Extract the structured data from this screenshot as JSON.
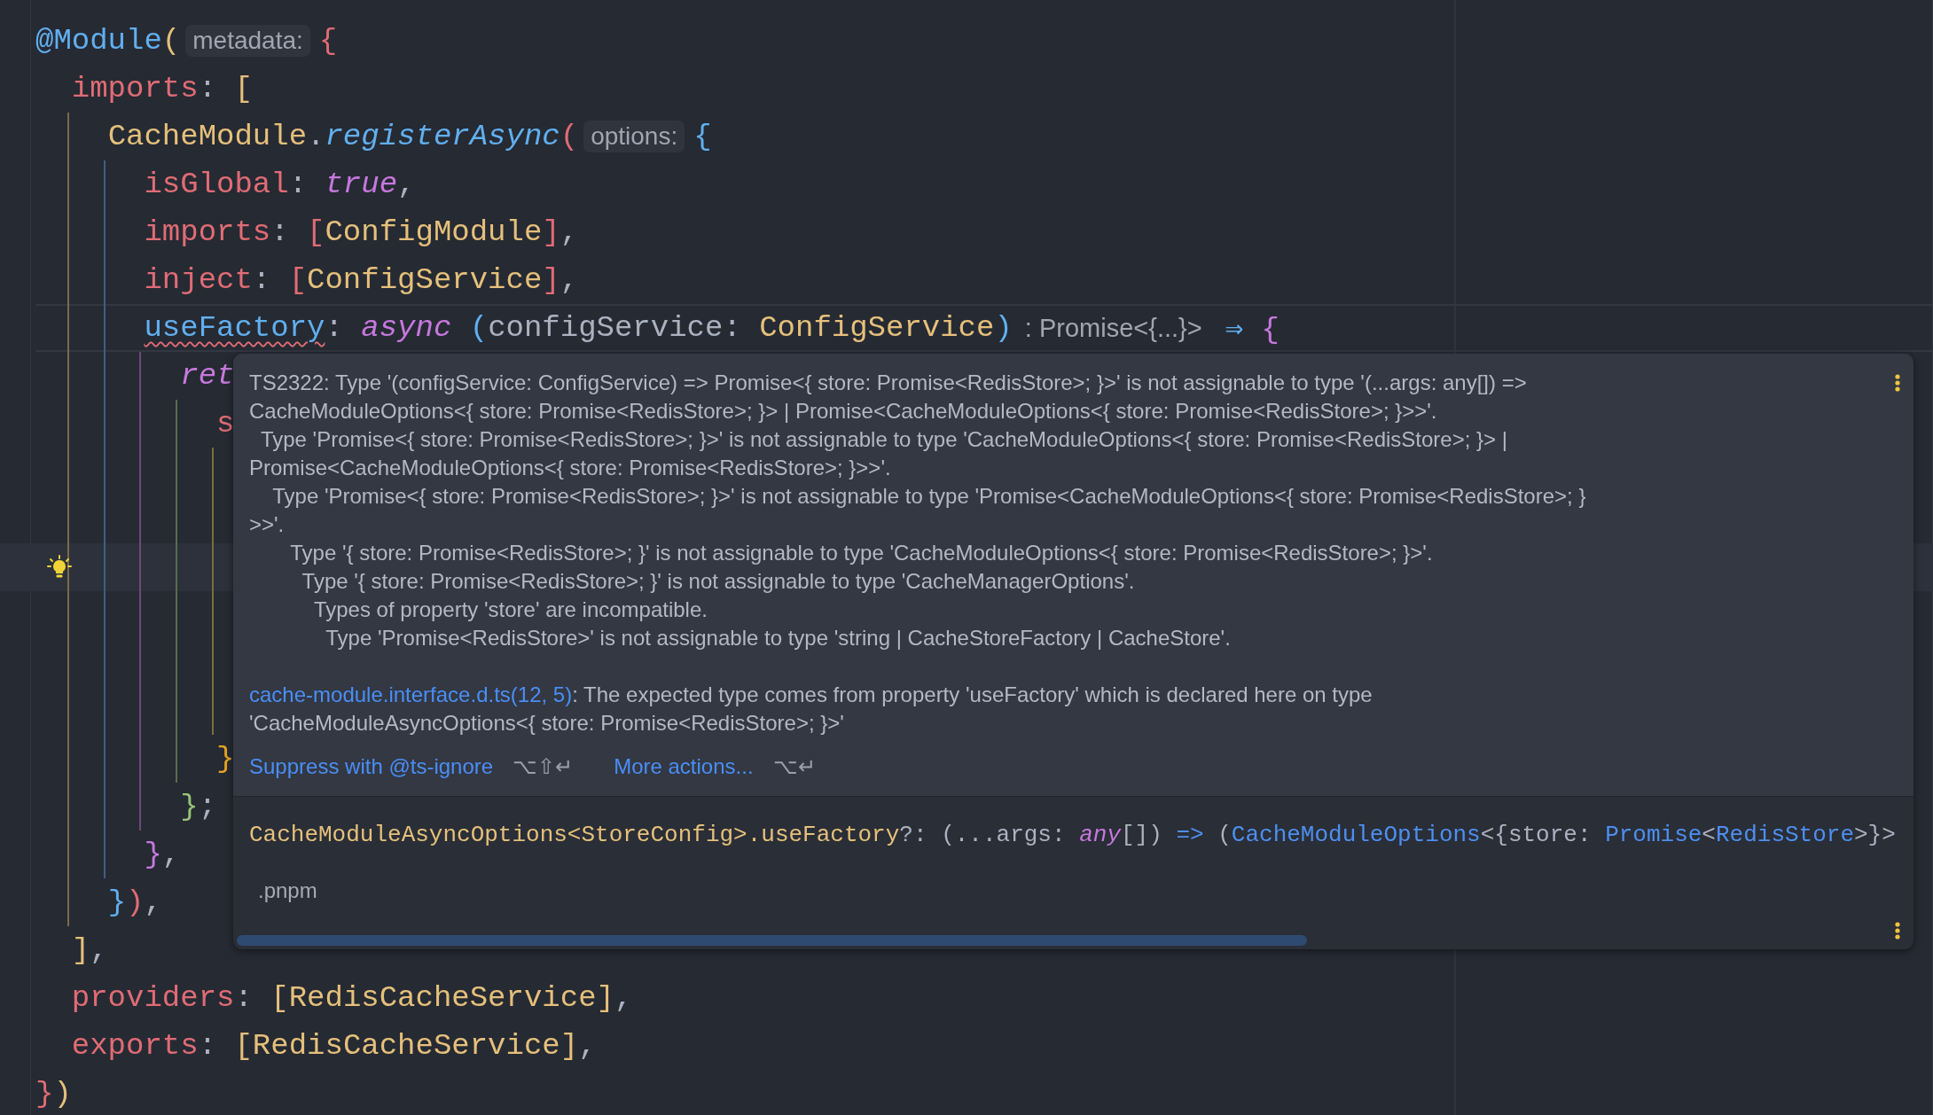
{
  "editor": {
    "lines": [
      {
        "current": false,
        "framed": false,
        "bulb": false,
        "segments": [
          {
            "kind": "code",
            "tokens": [
              {
                "text": "@Module",
                "kind": "decorator"
              },
              {
                "text": "(",
                "kind": "yellow"
              }
            ]
          },
          {
            "kind": "hint",
            "text": "metadata:"
          },
          {
            "kind": "code",
            "tokens": [
              {
                "text": "{",
                "kind": "red"
              }
            ]
          }
        ]
      },
      {
        "current": false,
        "framed": false,
        "bulb": false,
        "segments": [
          {
            "kind": "code",
            "tokens": [
              {
                "text": "  imports",
                "kind": "property"
              },
              {
                "text": ": ",
                "kind": "punct"
              },
              {
                "text": "[",
                "kind": "yellow"
              }
            ]
          }
        ]
      },
      {
        "current": false,
        "framed": false,
        "bulb": false,
        "segments": [
          {
            "kind": "code",
            "tokens": [
              {
                "text": "    CacheModule",
                "kind": "type"
              },
              {
                "text": ".",
                "kind": "punct"
              },
              {
                "text": "registerAsync",
                "kind": "function"
              },
              {
                "text": "(",
                "kind": "red"
              }
            ]
          },
          {
            "kind": "hint",
            "text": "options:"
          },
          {
            "kind": "code",
            "tokens": [
              {
                "text": "{",
                "kind": "blue"
              }
            ]
          }
        ]
      },
      {
        "current": false,
        "framed": false,
        "bulb": false,
        "segments": [
          {
            "kind": "code",
            "tokens": [
              {
                "text": "      isGlobal",
                "kind": "property"
              },
              {
                "text": ": ",
                "kind": "punct"
              },
              {
                "text": "true",
                "kind": "keyword"
              },
              {
                "text": ",",
                "kind": "punct"
              }
            ]
          }
        ]
      },
      {
        "current": false,
        "framed": false,
        "bulb": false,
        "segments": [
          {
            "kind": "code",
            "tokens": [
              {
                "text": "      imports",
                "kind": "property"
              },
              {
                "text": ": ",
                "kind": "punct"
              },
              {
                "text": "[",
                "kind": "red"
              },
              {
                "text": "ConfigModule",
                "kind": "type"
              },
              {
                "text": "]",
                "kind": "red"
              },
              {
                "text": ",",
                "kind": "punct"
              }
            ]
          }
        ]
      },
      {
        "current": false,
        "framed": false,
        "bulb": false,
        "segments": [
          {
            "kind": "code",
            "tokens": [
              {
                "text": "      inject",
                "kind": "property"
              },
              {
                "text": ": ",
                "kind": "punct"
              },
              {
                "text": "[",
                "kind": "red"
              },
              {
                "text": "ConfigService",
                "kind": "type"
              },
              {
                "text": "]",
                "kind": "red"
              },
              {
                "text": ",",
                "kind": "punct"
              }
            ]
          }
        ]
      },
      {
        "current": false,
        "framed": true,
        "bulb": false,
        "segments": [
          {
            "kind": "code",
            "tokens": [
              {
                "text": "      useFactory",
                "kind": "method",
                "error": true
              },
              {
                "text": ": ",
                "kind": "punct"
              },
              {
                "text": "async",
                "kind": "keyword"
              },
              {
                "text": " (",
                "kind": "blue"
              },
              {
                "text": "configService",
                "kind": "param"
              },
              {
                "text": ": ",
                "kind": "punct"
              },
              {
                "text": "ConfigService",
                "kind": "type"
              },
              {
                "text": ")",
                "kind": "blue"
              }
            ]
          },
          {
            "kind": "inlay",
            "text": ": Promise<{...}>"
          },
          {
            "kind": "code",
            "tokens": [
              {
                "text": "⇒ ",
                "kind": "blue"
              },
              {
                "text": "{",
                "kind": "purple"
              }
            ]
          }
        ]
      },
      {
        "current": false,
        "framed": false,
        "bulb": false,
        "segments": [
          {
            "kind": "code",
            "tokens": [
              {
                "text": "        ret",
                "kind": "keyword"
              }
            ]
          }
        ]
      },
      {
        "current": false,
        "framed": false,
        "bulb": false,
        "segments": [
          {
            "kind": "code",
            "tokens": [
              {
                "text": "          s",
                "kind": "property"
              }
            ]
          }
        ]
      },
      {
        "current": false,
        "framed": false,
        "bulb": false
      },
      {
        "current": false,
        "framed": false,
        "bulb": false
      },
      {
        "current": true,
        "framed": false,
        "bulb": true
      },
      {
        "current": false,
        "framed": false,
        "bulb": false
      },
      {
        "current": false,
        "framed": false,
        "bulb": false
      },
      {
        "current": false,
        "framed": false,
        "bulb": false
      },
      {
        "current": false,
        "framed": false,
        "bulb": false,
        "segments": [
          {
            "kind": "code",
            "tokens": [
              {
                "text": "          }",
                "kind": "orange"
              }
            ]
          }
        ]
      },
      {
        "current": false,
        "framed": false,
        "bulb": false,
        "segments": [
          {
            "kind": "code",
            "tokens": [
              {
                "text": "        }",
                "kind": "green"
              },
              {
                "text": ";",
                "kind": "punct"
              }
            ]
          }
        ]
      },
      {
        "current": false,
        "framed": false,
        "bulb": false,
        "segments": [
          {
            "kind": "code",
            "tokens": [
              {
                "text": "      }",
                "kind": "purple"
              },
              {
                "text": ",",
                "kind": "punct"
              }
            ]
          }
        ]
      },
      {
        "current": false,
        "framed": false,
        "bulb": false,
        "segments": [
          {
            "kind": "code",
            "tokens": [
              {
                "text": "    }",
                "kind": "blue"
              },
              {
                "text": ")",
                "kind": "red"
              },
              {
                "text": ",",
                "kind": "punct"
              }
            ]
          }
        ]
      },
      {
        "current": false,
        "framed": false,
        "bulb": false,
        "segments": [
          {
            "kind": "code",
            "tokens": [
              {
                "text": "  ]",
                "kind": "yellow"
              },
              {
                "text": ",",
                "kind": "punct"
              }
            ]
          }
        ]
      },
      {
        "current": false,
        "framed": false,
        "bulb": false,
        "segments": [
          {
            "kind": "code",
            "tokens": [
              {
                "text": "  providers",
                "kind": "property"
              },
              {
                "text": ": ",
                "kind": "punct"
              },
              {
                "text": "[",
                "kind": "yellow"
              },
              {
                "text": "RedisCacheService",
                "kind": "type"
              },
              {
                "text": "]",
                "kind": "yellow"
              },
              {
                "text": ",",
                "kind": "punct"
              }
            ]
          }
        ]
      },
      {
        "current": false,
        "framed": false,
        "bulb": false,
        "segments": [
          {
            "kind": "code",
            "tokens": [
              {
                "text": "  exports",
                "kind": "property"
              },
              {
                "text": ": ",
                "kind": "punct"
              },
              {
                "text": "[",
                "kind": "yellow"
              },
              {
                "text": "RedisCacheService",
                "kind": "type"
              },
              {
                "text": "]",
                "kind": "yellow"
              },
              {
                "text": ",",
                "kind": "punct"
              }
            ]
          }
        ]
      },
      {
        "current": false,
        "framed": false,
        "bulb": false,
        "segments": [
          {
            "kind": "code",
            "tokens": [
              {
                "text": "}",
                "kind": "red"
              },
              {
                "text": ")",
                "kind": "yellow"
              }
            ]
          }
        ]
      }
    ]
  },
  "popup": {
    "message_lines": [
      "TS2322: Type '(configService: ConfigService) => Promise<{ store: Promise<RedisStore>; }>' is not assignable to type '(...args: any[]) =>",
      "CacheModuleOptions<{ store: Promise<RedisStore>; }> | Promise<CacheModuleOptions<{ store: Promise<RedisStore>; }>>'.",
      "  Type 'Promise<{ store: Promise<RedisStore>; }>' is not assignable to type 'CacheModuleOptions<{ store: Promise<RedisStore>; }> |",
      "Promise<CacheModuleOptions<{ store: Promise<RedisStore>; }>>'.",
      "    Type 'Promise<{ store: Promise<RedisStore>; }>' is not assignable to type 'Promise<CacheModuleOptions<{ store: Promise<RedisStore>; }",
      ">>'.",
      "       Type '{ store: Promise<RedisStore>; }' is not assignable to type 'CacheModuleOptions<{ store: Promise<RedisStore>; }>'.",
      "         Type '{ store: Promise<RedisStore>; }' is not assignable to type 'CacheManagerOptions'.",
      "           Types of property 'store' are incompatible.",
      "             Type 'Promise<RedisStore>' is not assignable to type 'string | CacheStoreFactory | CacheStore'."
    ],
    "source_note": {
      "link": "cache-module.interface.d.ts(12, 5)",
      "lines": [
        ": The expected type comes from property 'useFactory' which is declared here on type",
        "'CacheModuleAsyncOptions<{ store: Promise<RedisStore>; }>'"
      ]
    },
    "actions": [
      {
        "label": "Suppress with @ts-ignore",
        "shortcut": "⌥⇧↵"
      },
      {
        "label": "More actions...",
        "shortcut": "⌥↵"
      }
    ],
    "signature": [
      {
        "text": "CacheModuleAsyncOptions<StoreConfig>.useFactory",
        "kind": "type"
      },
      {
        "text": "?: (...args: ",
        "kind": "punct"
      },
      {
        "text": "any",
        "kind": "keyword"
      },
      {
        "text": "[]) ",
        "kind": "punct"
      },
      {
        "text": "=>",
        "kind": "link"
      },
      {
        "text": " (",
        "kind": "punct"
      },
      {
        "text": "CacheModuleOptions",
        "kind": "link"
      },
      {
        "text": "<{store: ",
        "kind": "punct"
      },
      {
        "text": "Promise",
        "kind": "link"
      },
      {
        "text": "<",
        "kind": "punct"
      },
      {
        "text": "RedisStore",
        "kind": "link"
      },
      {
        "text": ">}>",
        "kind": "punct"
      }
    ],
    "location": ".pnpm"
  }
}
